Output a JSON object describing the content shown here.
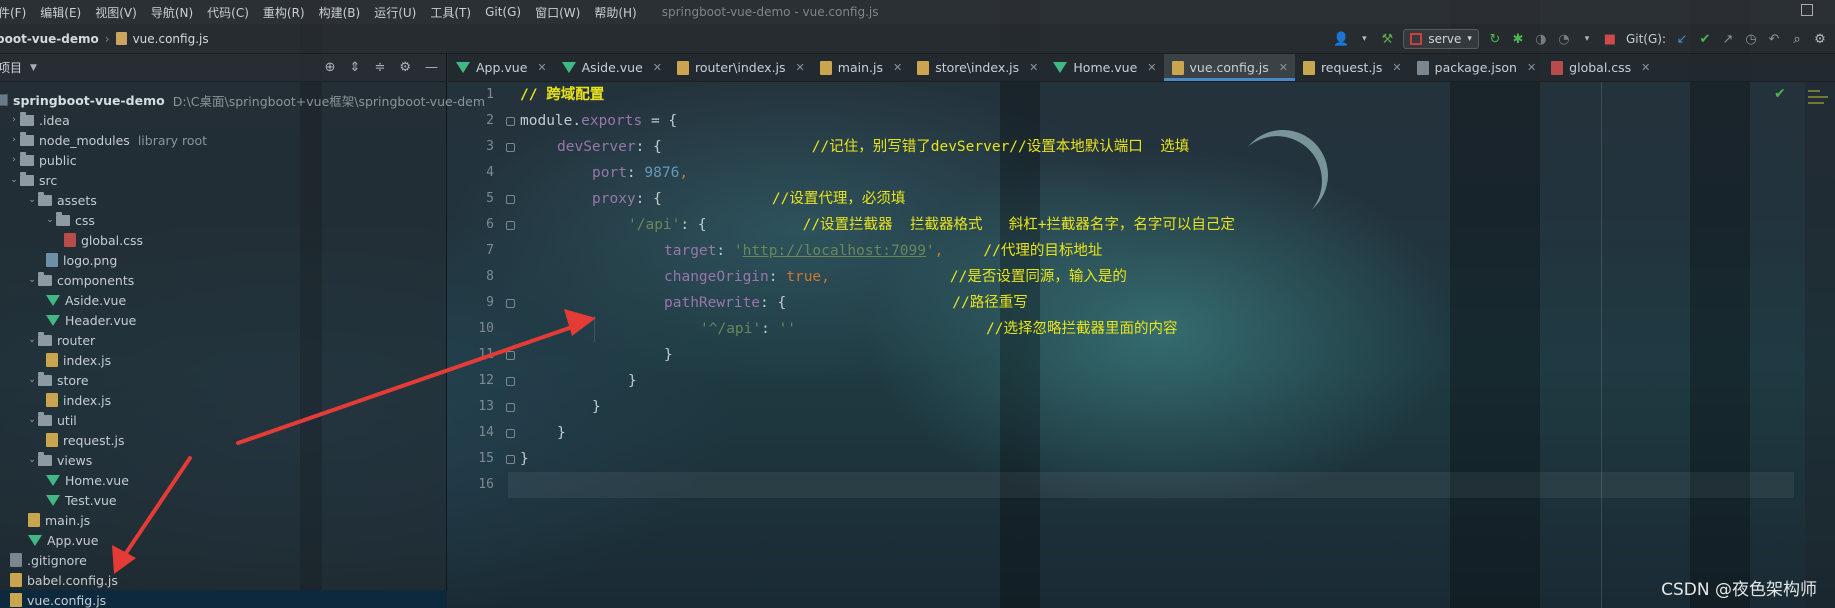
{
  "window_title": "springboot-vue-demo - vue.config.js",
  "menu": [
    "件(F)",
    "编辑(E)",
    "视图(V)",
    "导航(N)",
    "代码(C)",
    "重构(R)",
    "构建(B)",
    "运行(U)",
    "工具(T)",
    "Git(G)",
    "窗口(W)",
    "帮助(H)"
  ],
  "breadcrumb": {
    "project": "boot-vue-demo",
    "file": "vue.config.js"
  },
  "toolbar": {
    "run_config": "serve",
    "git_label": "Git(G):"
  },
  "project_panel": {
    "title": "项目",
    "root_name": "springboot-vue-demo",
    "root_path": "D:\\C桌面\\springboot+vue框架\\springboot-vue-dem",
    "nodes": [
      {
        "label": ".idea",
        "note": ""
      },
      {
        "label": "node_modules",
        "note": "library root"
      },
      {
        "label": "public",
        "note": ""
      },
      {
        "label": "src",
        "note": ""
      },
      {
        "label": "assets",
        "note": ""
      },
      {
        "label": "css",
        "note": ""
      },
      {
        "label": "global.css",
        "note": ""
      },
      {
        "label": "logo.png",
        "note": ""
      },
      {
        "label": "components",
        "note": ""
      },
      {
        "label": "Aside.vue",
        "note": ""
      },
      {
        "label": "Header.vue",
        "note": ""
      },
      {
        "label": "router",
        "note": ""
      },
      {
        "label": "index.js",
        "note": ""
      },
      {
        "label": "store",
        "note": ""
      },
      {
        "label": "index.js",
        "note": ""
      },
      {
        "label": "util",
        "note": ""
      },
      {
        "label": "request.js",
        "note": ""
      },
      {
        "label": "views",
        "note": ""
      },
      {
        "label": "Home.vue",
        "note": ""
      },
      {
        "label": "Test.vue",
        "note": ""
      },
      {
        "label": "main.js",
        "note": ""
      },
      {
        "label": "App.vue",
        "note": ""
      },
      {
        "label": ".gitignore",
        "note": ""
      },
      {
        "label": "babel.config.js",
        "note": ""
      },
      {
        "label": "vue.config.js",
        "note": ""
      }
    ]
  },
  "tabs": [
    "App.vue",
    "Aside.vue",
    "router\\index.js",
    "main.js",
    "store\\index.js",
    "Home.vue",
    "vue.config.js",
    "request.js",
    "package.json",
    "global.css"
  ],
  "active_tab": "vue.config.js",
  "code": {
    "line_numbers": [
      "1",
      "2",
      "3",
      "4",
      "5",
      "6",
      "7",
      "8",
      "9",
      "10",
      "11",
      "12",
      "13",
      "14",
      "15",
      "16"
    ],
    "l1": "// 跨域配置",
    "l2_a": "module.",
    "l2_b": "exports",
    "l2_c": " = {",
    "l3_a": "devServer",
    "l3_b": ": {",
    "l3_c": "//记住，别写错了devServer//设置本地默认端口  选填",
    "l4_a": "port",
    "l4_b": ": ",
    "l4_c": "9876",
    "l4_d": ",",
    "l5_a": "proxy",
    "l5_b": ": {",
    "l5_c": "//设置代理，必须填",
    "l6_a": "'/api'",
    "l6_b": ": {",
    "l6_c": "//设置拦截器  拦截器格式   斜杠+拦截器名字，名字可以自己定",
    "l7_a": "target",
    "l7_b": ": ",
    "l7_c": "'",
    "l7_d": "http://localhost:7099",
    "l7_e": "'",
    "l7_f": ",",
    "l7_g": "//代理的目标地址",
    "l8_a": "changeOrigin",
    "l8_b": ": ",
    "l8_c": "true",
    "l8_d": ",",
    "l8_e": "//是否设置同源，输入是的",
    "l9_a": "pathRewrite",
    "l9_b": ": {",
    "l9_c": "//路径重写",
    "l10_a": "'^/api'",
    "l10_b": ": ",
    "l10_c": "''",
    "l10_d": "//选择忽略拦截器里面的内容",
    "l11": "}",
    "l12": "}",
    "l13": "}",
    "l14": "}",
    "l15": "}"
  },
  "watermark": "CSDN @夜色架构师",
  "colors": {
    "comment": "#e8e41b",
    "keyword": "#cc7832",
    "property": "#9876aa",
    "number": "#6897bb",
    "string": "#6a8759",
    "arrow": "#e53b36"
  }
}
